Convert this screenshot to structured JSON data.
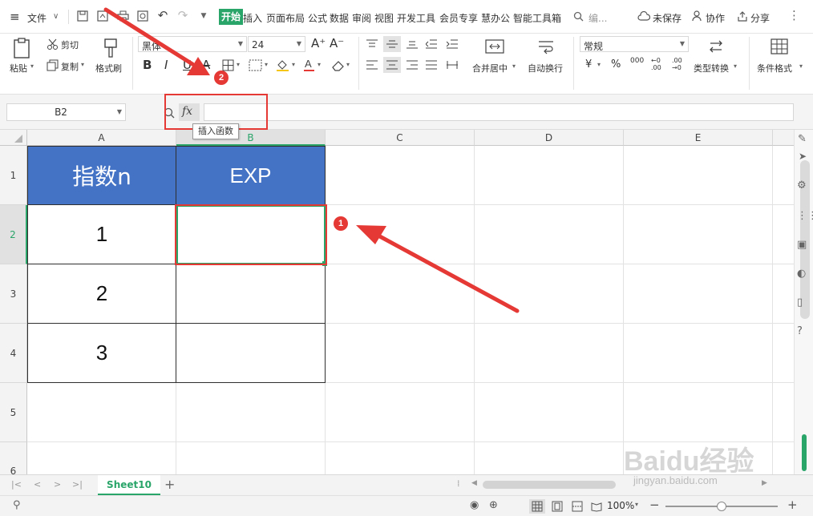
{
  "menubar": {
    "hamburger": "≡",
    "file_label": "文件",
    "tabs": [
      "开始",
      "插入",
      "页面布局",
      "公式",
      "数据",
      "审阅",
      "视图",
      "开发工具",
      "会员专享",
      "慧办公",
      "智能工具箱"
    ],
    "search_label": "编...",
    "unsaved_label": "未保存",
    "collab_label": "协作",
    "share_label": "分享"
  },
  "ribbon": {
    "paste_label": "粘贴",
    "cut_label": "剪切",
    "copy_label": "复制",
    "format_painter_label": "格式刷",
    "font_name": "黑体",
    "font_size": "24",
    "merge_center_label": "合并居中",
    "auto_wrap_label": "自动换行",
    "number_format": "常规",
    "type_convert_label": "类型转换",
    "conditional_format_label": "条件格式",
    "bold": "B",
    "percent": "%",
    "thousands": "000",
    "dec_inc": "←0 .00",
    "dec_dec": ".00 →0",
    "currency": "¥"
  },
  "formula_bar": {
    "name_box": "B2",
    "fx_label": "fx",
    "tooltip": "插入函数",
    "formula_value": ""
  },
  "columns": [
    "A",
    "B",
    "C",
    "D",
    "E"
  ],
  "rows": [
    "1",
    "2",
    "3",
    "4",
    "5",
    "6"
  ],
  "table": {
    "header": [
      "指数n",
      "EXP"
    ],
    "body": [
      [
        "1",
        ""
      ],
      [
        "2",
        ""
      ],
      [
        "3",
        ""
      ]
    ]
  },
  "colors": {
    "header_fill": "#4472C4",
    "accent_green": "#2aa56a",
    "annotation_red": "#e53935"
  },
  "annotations": {
    "badge1": "1",
    "badge2": "2"
  },
  "sheet_tab": "Sheet10",
  "status": {
    "zoom": "100%",
    "add_sheet": "+"
  },
  "watermark": {
    "brand": "Baidu经验",
    "url": "jingyan.baidu.com"
  }
}
